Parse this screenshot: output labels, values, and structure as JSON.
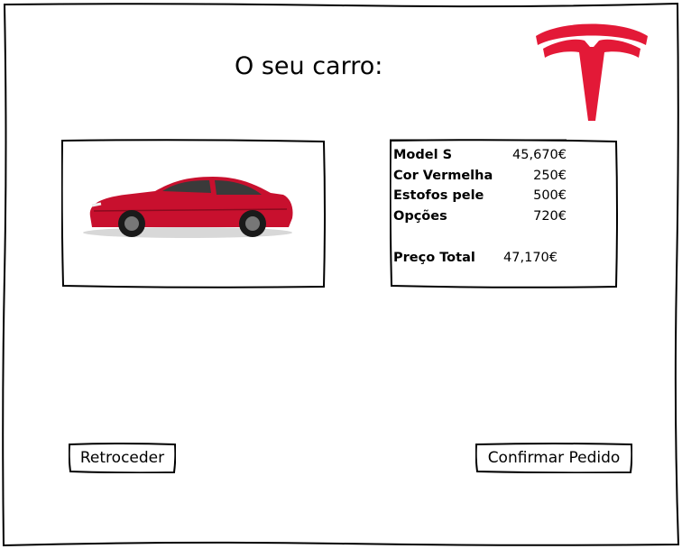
{
  "page": {
    "title": "O seu carro:"
  },
  "brand": {
    "logo": "tesla-logo",
    "accent_color": "#e31937"
  },
  "car": {
    "image": "car-image",
    "color": "#c8102e"
  },
  "summary": {
    "items": [
      {
        "label": "Model S",
        "value": "45,670€"
      },
      {
        "label": "Cor Vermelha",
        "value": "250€"
      },
      {
        "label": "Estofos pele",
        "value": "500€"
      },
      {
        "label": "Opções",
        "value": "720€"
      }
    ],
    "total": {
      "label": "Preço Total",
      "value": "47,170€"
    }
  },
  "actions": {
    "back_label": "Retroceder",
    "confirm_label": "Confirmar Pedido"
  }
}
